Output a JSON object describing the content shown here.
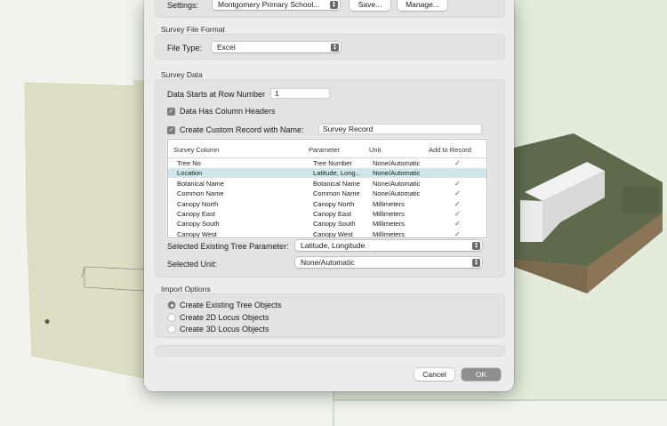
{
  "header": {
    "settings_label": "Settings:",
    "settings_value": "Montgomery Primary School...",
    "save_label": "Save...",
    "manage_label": "Manage..."
  },
  "file_format": {
    "section_title": "Survey File Format",
    "file_type_label": "File Type:",
    "file_type_value": "Excel"
  },
  "survey_data": {
    "section_title": "Survey Data",
    "start_row_label": "Data Starts at Row Number",
    "start_row_value": "1",
    "headers_label": "Data Has Column Headers",
    "custom_record_label": "Create Custom Record with Name:",
    "custom_record_value": "Survey Record",
    "table": {
      "columns": [
        "Survey Column",
        "Parameter",
        "Unit",
        "Add to Record"
      ],
      "rows": [
        {
          "col": "Tree No",
          "param": "Tree Number",
          "unit": "None/Automatic",
          "add": "✓"
        },
        {
          "col": "Location",
          "param": "Latitude, Long...",
          "unit": "None/Automatic",
          "add": ""
        },
        {
          "col": "Botanical Name",
          "param": "Botanical Name",
          "unit": "None/Automatic",
          "add": "✓"
        },
        {
          "col": "Common Name",
          "param": "Common Name",
          "unit": "None/Automatic",
          "add": "✓"
        },
        {
          "col": "Canopy North",
          "param": "Canopy North",
          "unit": "Millimeters",
          "add": "✓"
        },
        {
          "col": "Canopy East",
          "param": "Canopy East",
          "unit": "Millimeters",
          "add": "✓"
        },
        {
          "col": "Canopy South",
          "param": "Canopy South",
          "unit": "Millimeters",
          "add": "✓"
        },
        {
          "col": "Canopy West",
          "param": "Canopy West",
          "unit": "Millimeters",
          "add": "✓"
        }
      ]
    },
    "existing_param_label": "Selected Existing Tree Parameter:",
    "existing_param_value": "Latitude, Longitude",
    "unit_label": "Selected Unit:",
    "unit_value": "None/Automatic"
  },
  "import_options": {
    "section_title": "Import Options",
    "options": [
      "Create Existing Tree Objects",
      "Create 2D Locus Objects",
      "Create 3D Locus Objects"
    ],
    "selected_index": 0
  },
  "footer": {
    "cancel_label": "Cancel",
    "ok_label": "OK"
  }
}
